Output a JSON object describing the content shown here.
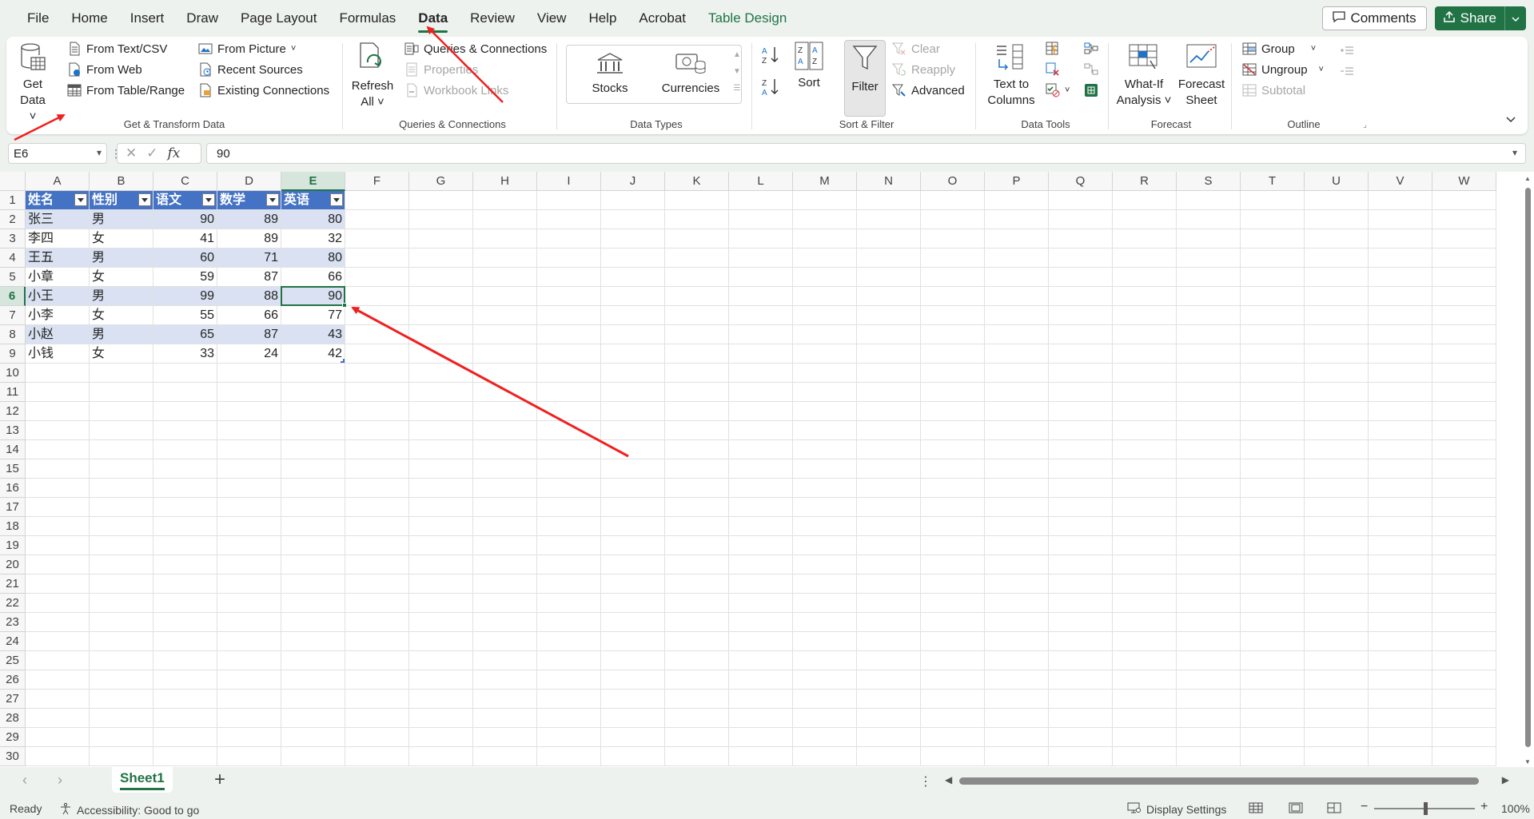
{
  "menu": {
    "tabs": [
      "File",
      "Home",
      "Insert",
      "Draw",
      "Page Layout",
      "Formulas",
      "Data",
      "Review",
      "View",
      "Help",
      "Acrobat",
      "Table Design"
    ],
    "comments_label": "Comments",
    "share_label": "Share"
  },
  "ribbon": {
    "get_transform": {
      "get_data": "Get",
      "get_data2": "Data",
      "from_text_csv": "From Text/CSV",
      "from_web": "From Web",
      "from_table_range": "From Table/Range",
      "from_picture": "From Picture",
      "recent_sources": "Recent Sources",
      "existing_connections": "Existing Connections",
      "label": "Get & Transform Data"
    },
    "queries": {
      "refresh_all": "Refresh",
      "refresh_all2": "All",
      "queries_connections": "Queries & Connections",
      "properties": "Properties",
      "workbook_links": "Workbook Links",
      "label": "Queries & Connections"
    },
    "data_types": {
      "stocks": "Stocks",
      "currencies": "Currencies",
      "label": "Data Types"
    },
    "sort_filter": {
      "sort": "Sort",
      "filter": "Filter",
      "clear": "Clear",
      "reapply": "Reapply",
      "advanced": "Advanced",
      "label": "Sort & Filter"
    },
    "data_tools": {
      "text_to_columns": "Text to",
      "text_to_columns2": "Columns",
      "label": "Data Tools"
    },
    "forecast": {
      "what_if": "What-If",
      "what_if2": "Analysis",
      "forecast_sheet": "Forecast",
      "forecast_sheet2": "Sheet",
      "label": "Forecast"
    },
    "outline": {
      "group": "Group",
      "ungroup": "Ungroup",
      "subtotal": "Subtotal",
      "label": "Outline"
    }
  },
  "formula_bar": {
    "name_box": "E6",
    "formula": "90",
    "fx": "fx"
  },
  "grid": {
    "columns": [
      "A",
      "B",
      "C",
      "D",
      "E",
      "F",
      "G",
      "H",
      "I",
      "J",
      "K",
      "L",
      "M",
      "N",
      "O",
      "P",
      "Q",
      "R",
      "S",
      "T",
      "U",
      "V",
      "W"
    ],
    "rows": [
      "1",
      "2",
      "3",
      "4",
      "5",
      "6",
      "7",
      "8",
      "9",
      "10",
      "11",
      "12",
      "13",
      "14",
      "15",
      "16",
      "17",
      "18",
      "19",
      "20",
      "21",
      "22",
      "23",
      "24",
      "25",
      "26",
      "27",
      "28",
      "29",
      "30"
    ],
    "table_headers": [
      "姓名",
      "性别",
      "语文",
      "数学",
      "英语"
    ],
    "table_rows": [
      [
        "张三",
        "男",
        "90",
        "89",
        "80"
      ],
      [
        "李四",
        "女",
        "41",
        "89",
        "32"
      ],
      [
        "王五",
        "男",
        "60",
        "71",
        "80"
      ],
      [
        "小章",
        "女",
        "59",
        "87",
        "66"
      ],
      [
        "小王",
        "男",
        "99",
        "88",
        "90"
      ],
      [
        "小李",
        "女",
        "55",
        "66",
        "77"
      ],
      [
        "小赵",
        "男",
        "65",
        "87",
        "43"
      ],
      [
        "小钱",
        "女",
        "33",
        "24",
        "42"
      ]
    ],
    "active_cell": "E6",
    "active_col": "E",
    "active_row": "6"
  },
  "sheet_tabs": {
    "tabs": [
      "Sheet1"
    ],
    "add": "+"
  },
  "status": {
    "ready": "Ready",
    "accessibility": "Accessibility: Good to go",
    "display_settings": "Display Settings",
    "zoom": "100%",
    "zoom_minus": "−",
    "zoom_plus": "+"
  },
  "colors": {
    "accent": "#217346",
    "table_header": "#4472c4",
    "table_band": "#d9e1f2",
    "annotation_arrow": "#f02020"
  }
}
